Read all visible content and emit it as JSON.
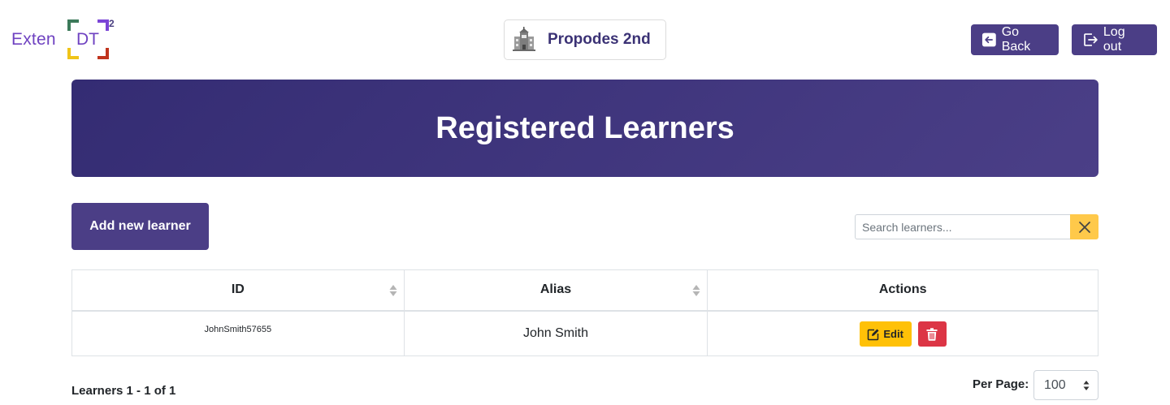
{
  "logo": {
    "text": "Exten",
    "dt": "DT",
    "sup": "2"
  },
  "school": {
    "name": "Propodes 2nd",
    "icon": "school-building-icon"
  },
  "header": {
    "go_back": "Go Back",
    "log_out": "Log out"
  },
  "banner": {
    "title": "Registered Learners"
  },
  "controls": {
    "add_learner": "Add new learner",
    "search_placeholder": "Search learners..."
  },
  "table": {
    "columns": [
      "ID",
      "Alias",
      "Actions"
    ],
    "rows": [
      {
        "id": "JohnSmith57655",
        "alias": "John Smith",
        "edit_label": "Edit"
      }
    ]
  },
  "footer": {
    "count": "Learners 1 - 1 of 1",
    "per_page_label": "Per Page:",
    "per_page_value": "100"
  },
  "colors": {
    "primary": "#4b3e86",
    "banner": "#342c73",
    "warning": "#ffc107",
    "danger": "#dc3545"
  }
}
